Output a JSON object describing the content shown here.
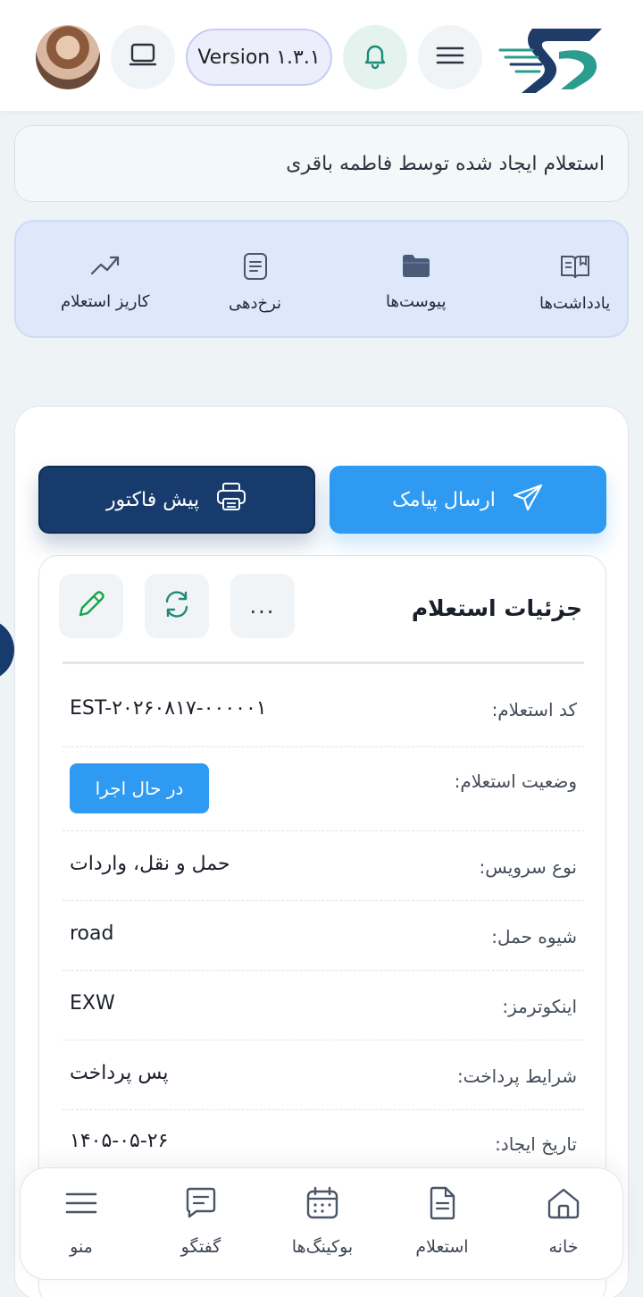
{
  "header": {
    "version_label": "Version ۱.۳.۱",
    "icons": [
      "avatar",
      "laptop-icon",
      "bell-icon",
      "hamburger-icon",
      "logo"
    ]
  },
  "banner": {
    "text": "استعلام ایجاد شده توسط فاطمه باقری"
  },
  "quick_actions": {
    "notes": "یادداشت‌ها",
    "attachments": "پیوست‌ها",
    "pricing": "نرخ‌دهی",
    "timeline": "کاریز استعلام"
  },
  "actions": {
    "send_sms": "ارسال پیامک",
    "proforma": "پیش فاکتور"
  },
  "details": {
    "title": "جزئیات استعلام",
    "more_label": "...",
    "rows": [
      {
        "label": "کد استعلام:",
        "value": "EST-۲۰۲۶۰۸۱۷-۰۰۰۰۰۱"
      },
      {
        "label": "وضعیت استعلام:",
        "value": "در حال اجرا"
      },
      {
        "label": "نوع سرویس:",
        "value": "حمل و نقل، واردات"
      },
      {
        "label": "شیوه حمل:",
        "value": "road"
      },
      {
        "label": "اینکوترمز:",
        "value": "EXW"
      },
      {
        "label": "شرایط پرداخت:",
        "value": "پس پرداخت"
      },
      {
        "label": "تاریخ ایجاد:",
        "value": "۱۴۰۵-۰۵-۲۶"
      }
    ]
  },
  "bottom_nav": {
    "home": "خانه",
    "inquiry": "استعلام",
    "bookings": "بوکینگ‌ها",
    "chat": "گفتگو",
    "menu": "منو"
  },
  "colors": {
    "primary": "#2f9af2",
    "navy": "#173b6c",
    "quick_bg": "#dde8fb"
  }
}
